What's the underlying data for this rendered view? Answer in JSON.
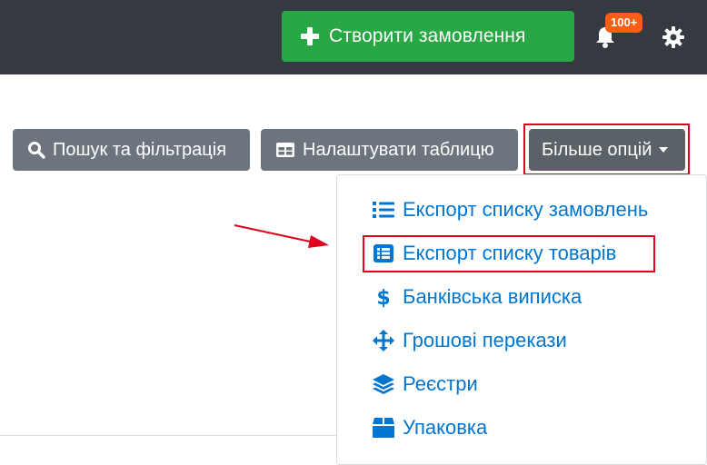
{
  "header": {
    "create_order_label": "Створити замовлення",
    "notification_badge": "100+"
  },
  "toolbar": {
    "search_filter_label": "Пошук та фільтрація",
    "configure_table_label": "Налаштувати таблицю",
    "more_options_label": "Більше опцій"
  },
  "dropdown": {
    "items": [
      {
        "label": "Експорт списку замовлень",
        "icon": "list-icon"
      },
      {
        "label": "Експорт списку товарів",
        "icon": "list-alt-icon"
      },
      {
        "label": "Банківська виписка",
        "icon": "dollar-icon"
      },
      {
        "label": "Грошові перекази",
        "icon": "arrows-icon"
      },
      {
        "label": "Реєстри",
        "icon": "layers-icon"
      },
      {
        "label": "Упаковка",
        "icon": "box-icon"
      }
    ]
  },
  "colors": {
    "topbar": "#343a40",
    "success": "#28a745",
    "secondary": "#6c757d",
    "link": "#0076d1",
    "badge": "#fd5e14",
    "highlight": "#e0001b"
  }
}
